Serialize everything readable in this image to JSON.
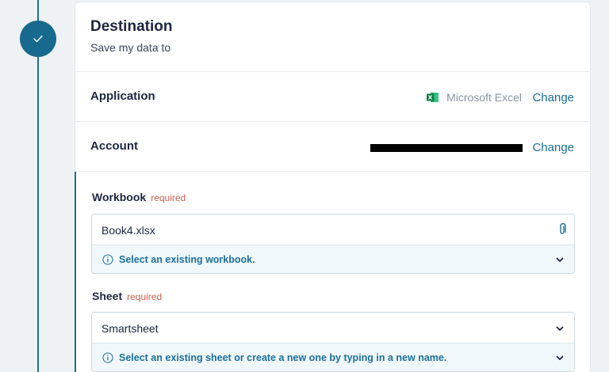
{
  "destination": {
    "title": "Destination",
    "subtitle": "Save my data to"
  },
  "application": {
    "label": "Application",
    "value": "Microsoft Excel",
    "value_icon": "excel-icon",
    "change_label": "Change"
  },
  "account": {
    "label": "Account",
    "value_redacted": true,
    "change_label": "Change"
  },
  "workbook": {
    "label": "Workbook",
    "required_label": "required",
    "value": "Book4.xlsx",
    "hint": "Select an existing workbook."
  },
  "sheet": {
    "label": "Sheet",
    "required_label": "required",
    "value": "Smartsheet",
    "hint": "Select an existing sheet or create a new one by typing in a new name."
  },
  "colors": {
    "accent": "#1a6f99",
    "step_circle": "#17698e",
    "required": "#c9604f",
    "hint_bg": "#f1f8fb"
  }
}
